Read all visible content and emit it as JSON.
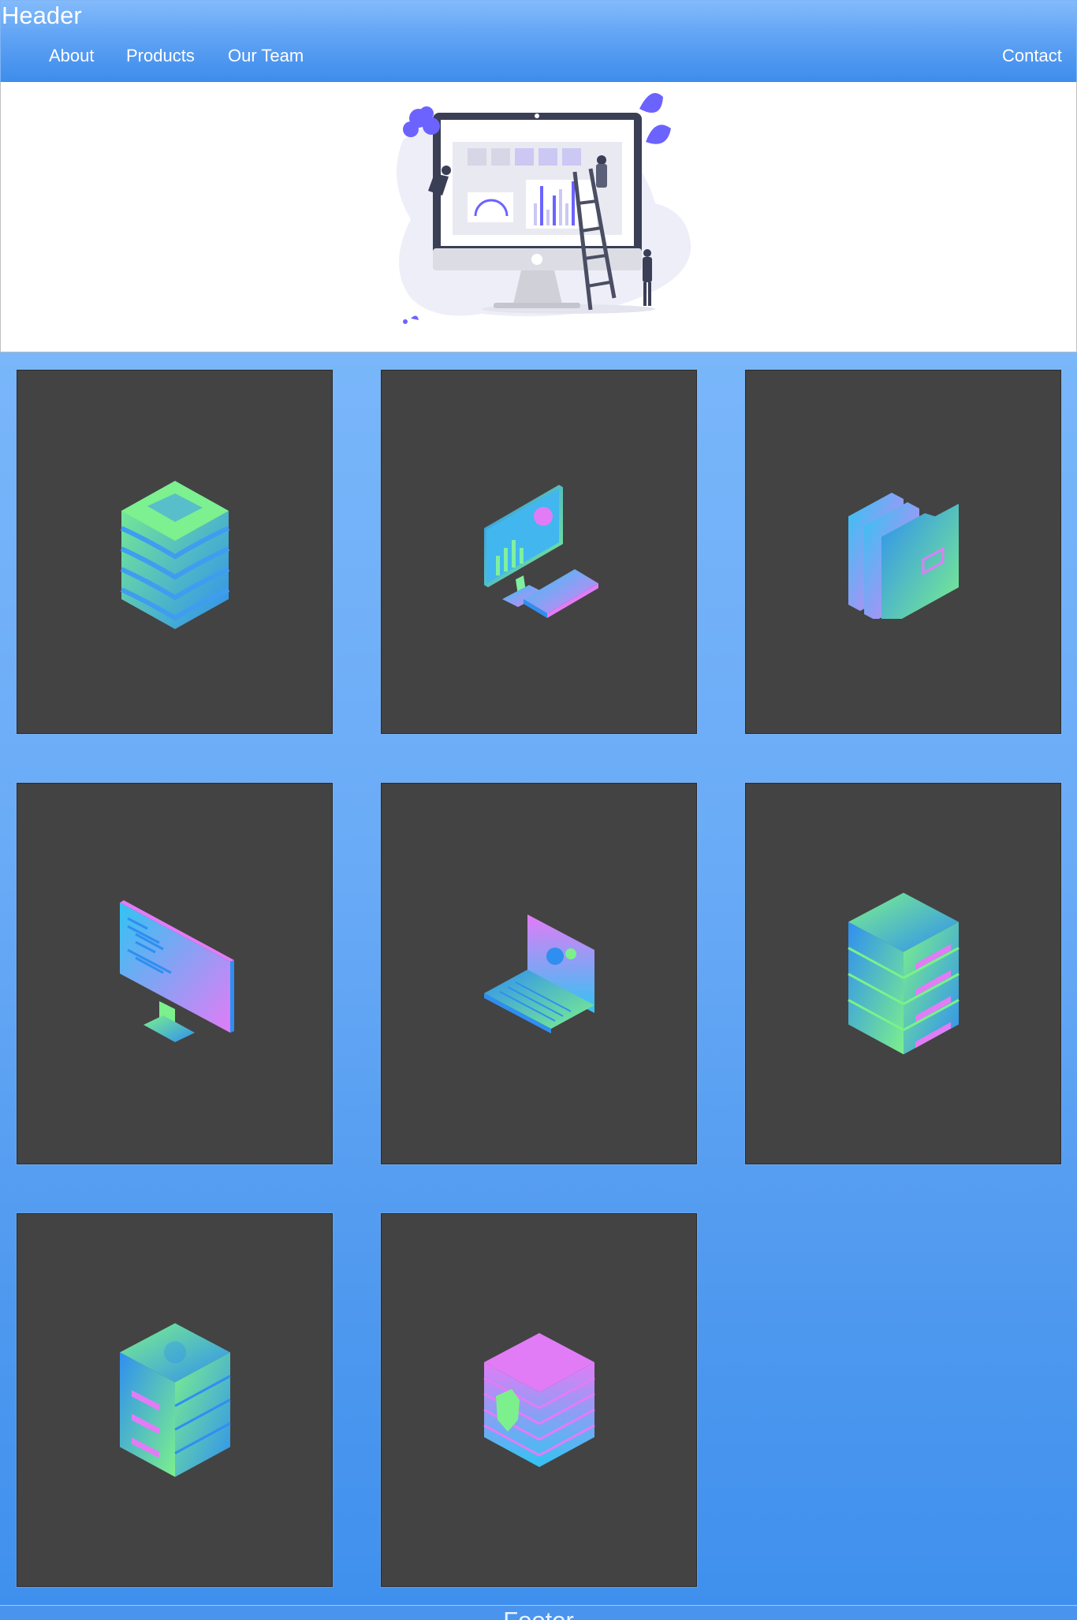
{
  "header": {
    "title": "Header",
    "nav": {
      "about": "About",
      "products": "Products",
      "our_team": "Our Team",
      "contact": "Contact"
    }
  },
  "hero": {
    "illustration": "dashboard-monitor-team-illustration"
  },
  "cards": [
    {
      "icon": "database-stack-icon"
    },
    {
      "icon": "analytics-desktop-icon"
    },
    {
      "icon": "folders-icon"
    },
    {
      "icon": "code-monitor-icon"
    },
    {
      "icon": "laptop-settings-icon"
    },
    {
      "icon": "server-rack-icon"
    },
    {
      "icon": "server-tower-icon"
    },
    {
      "icon": "secure-database-icon"
    }
  ],
  "footer": {
    "text": "Footer"
  },
  "colors": {
    "header_top": "#83bbfb",
    "header_bottom": "#3e8cec",
    "card_bg": "#434343",
    "grid_top": "#79b6fa",
    "grid_bottom": "#3f90ee"
  }
}
